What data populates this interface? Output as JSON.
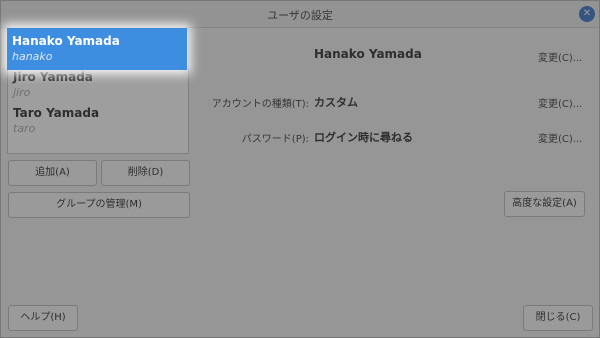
{
  "window": {
    "title": "ユーザの設定",
    "close_icon": "close-icon"
  },
  "users": [
    {
      "name": "Hanako Yamada",
      "login": "hanako",
      "selected": true
    },
    {
      "name": "Jiro Yamada",
      "login": "jiro",
      "selected": false
    },
    {
      "name": "Taro Yamada",
      "login": "taro",
      "selected": false
    }
  ],
  "buttons": {
    "add": "追加(A)",
    "delete": "削除(D)",
    "manage_groups": "グループの管理(M)",
    "advanced": "高度な設定(A)",
    "help": "ヘルプ(H)",
    "close": "閉じる(C)"
  },
  "details": {
    "full_name": "Hanako Yamada",
    "full_name_change": "変更(C)...",
    "account_type_label": "アカウントの種類(T):",
    "account_type_value": "カスタム",
    "account_type_change": "変更(C)...",
    "password_label": "パスワード(P):",
    "password_value": "ログイン時に尋ねる",
    "password_change": "変更(C)..."
  },
  "colors": {
    "selection": "#3d8ee0",
    "close_button": "#3d7bc9"
  }
}
